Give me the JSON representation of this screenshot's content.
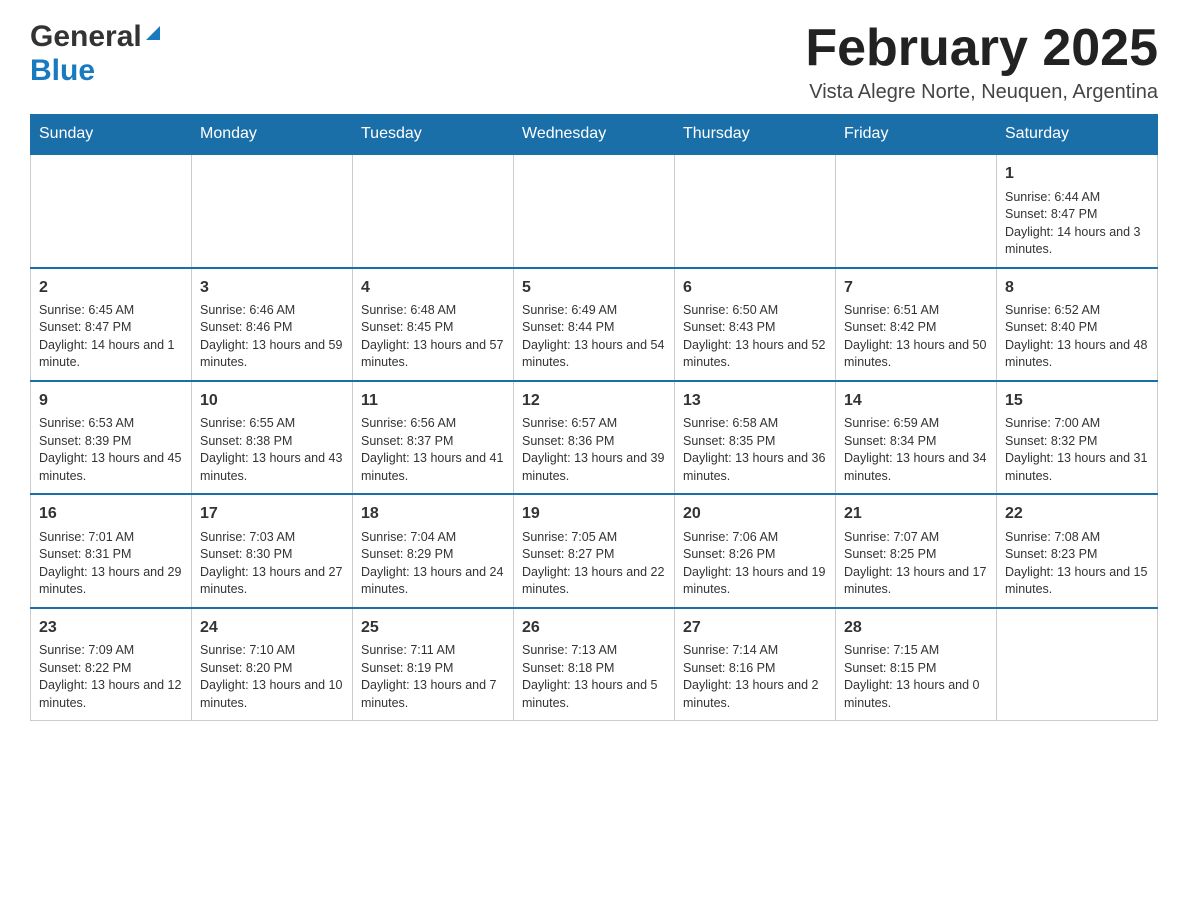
{
  "header": {
    "logo": {
      "general": "General",
      "blue": "Blue"
    },
    "title": "February 2025",
    "location": "Vista Alegre Norte, Neuquen, Argentina"
  },
  "calendar": {
    "days_of_week": [
      "Sunday",
      "Monday",
      "Tuesday",
      "Wednesday",
      "Thursday",
      "Friday",
      "Saturday"
    ],
    "weeks": [
      [
        {
          "day": "",
          "info": ""
        },
        {
          "day": "",
          "info": ""
        },
        {
          "day": "",
          "info": ""
        },
        {
          "day": "",
          "info": ""
        },
        {
          "day": "",
          "info": ""
        },
        {
          "day": "",
          "info": ""
        },
        {
          "day": "1",
          "info": "Sunrise: 6:44 AM\nSunset: 8:47 PM\nDaylight: 14 hours and 3 minutes."
        }
      ],
      [
        {
          "day": "2",
          "info": "Sunrise: 6:45 AM\nSunset: 8:47 PM\nDaylight: 14 hours and 1 minute."
        },
        {
          "day": "3",
          "info": "Sunrise: 6:46 AM\nSunset: 8:46 PM\nDaylight: 13 hours and 59 minutes."
        },
        {
          "day": "4",
          "info": "Sunrise: 6:48 AM\nSunset: 8:45 PM\nDaylight: 13 hours and 57 minutes."
        },
        {
          "day": "5",
          "info": "Sunrise: 6:49 AM\nSunset: 8:44 PM\nDaylight: 13 hours and 54 minutes."
        },
        {
          "day": "6",
          "info": "Sunrise: 6:50 AM\nSunset: 8:43 PM\nDaylight: 13 hours and 52 minutes."
        },
        {
          "day": "7",
          "info": "Sunrise: 6:51 AM\nSunset: 8:42 PM\nDaylight: 13 hours and 50 minutes."
        },
        {
          "day": "8",
          "info": "Sunrise: 6:52 AM\nSunset: 8:40 PM\nDaylight: 13 hours and 48 minutes."
        }
      ],
      [
        {
          "day": "9",
          "info": "Sunrise: 6:53 AM\nSunset: 8:39 PM\nDaylight: 13 hours and 45 minutes."
        },
        {
          "day": "10",
          "info": "Sunrise: 6:55 AM\nSunset: 8:38 PM\nDaylight: 13 hours and 43 minutes."
        },
        {
          "day": "11",
          "info": "Sunrise: 6:56 AM\nSunset: 8:37 PM\nDaylight: 13 hours and 41 minutes."
        },
        {
          "day": "12",
          "info": "Sunrise: 6:57 AM\nSunset: 8:36 PM\nDaylight: 13 hours and 39 minutes."
        },
        {
          "day": "13",
          "info": "Sunrise: 6:58 AM\nSunset: 8:35 PM\nDaylight: 13 hours and 36 minutes."
        },
        {
          "day": "14",
          "info": "Sunrise: 6:59 AM\nSunset: 8:34 PM\nDaylight: 13 hours and 34 minutes."
        },
        {
          "day": "15",
          "info": "Sunrise: 7:00 AM\nSunset: 8:32 PM\nDaylight: 13 hours and 31 minutes."
        }
      ],
      [
        {
          "day": "16",
          "info": "Sunrise: 7:01 AM\nSunset: 8:31 PM\nDaylight: 13 hours and 29 minutes."
        },
        {
          "day": "17",
          "info": "Sunrise: 7:03 AM\nSunset: 8:30 PM\nDaylight: 13 hours and 27 minutes."
        },
        {
          "day": "18",
          "info": "Sunrise: 7:04 AM\nSunset: 8:29 PM\nDaylight: 13 hours and 24 minutes."
        },
        {
          "day": "19",
          "info": "Sunrise: 7:05 AM\nSunset: 8:27 PM\nDaylight: 13 hours and 22 minutes."
        },
        {
          "day": "20",
          "info": "Sunrise: 7:06 AM\nSunset: 8:26 PM\nDaylight: 13 hours and 19 minutes."
        },
        {
          "day": "21",
          "info": "Sunrise: 7:07 AM\nSunset: 8:25 PM\nDaylight: 13 hours and 17 minutes."
        },
        {
          "day": "22",
          "info": "Sunrise: 7:08 AM\nSunset: 8:23 PM\nDaylight: 13 hours and 15 minutes."
        }
      ],
      [
        {
          "day": "23",
          "info": "Sunrise: 7:09 AM\nSunset: 8:22 PM\nDaylight: 13 hours and 12 minutes."
        },
        {
          "day": "24",
          "info": "Sunrise: 7:10 AM\nSunset: 8:20 PM\nDaylight: 13 hours and 10 minutes."
        },
        {
          "day": "25",
          "info": "Sunrise: 7:11 AM\nSunset: 8:19 PM\nDaylight: 13 hours and 7 minutes."
        },
        {
          "day": "26",
          "info": "Sunrise: 7:13 AM\nSunset: 8:18 PM\nDaylight: 13 hours and 5 minutes."
        },
        {
          "day": "27",
          "info": "Sunrise: 7:14 AM\nSunset: 8:16 PM\nDaylight: 13 hours and 2 minutes."
        },
        {
          "day": "28",
          "info": "Sunrise: 7:15 AM\nSunset: 8:15 PM\nDaylight: 13 hours and 0 minutes."
        },
        {
          "day": "",
          "info": ""
        }
      ]
    ]
  }
}
